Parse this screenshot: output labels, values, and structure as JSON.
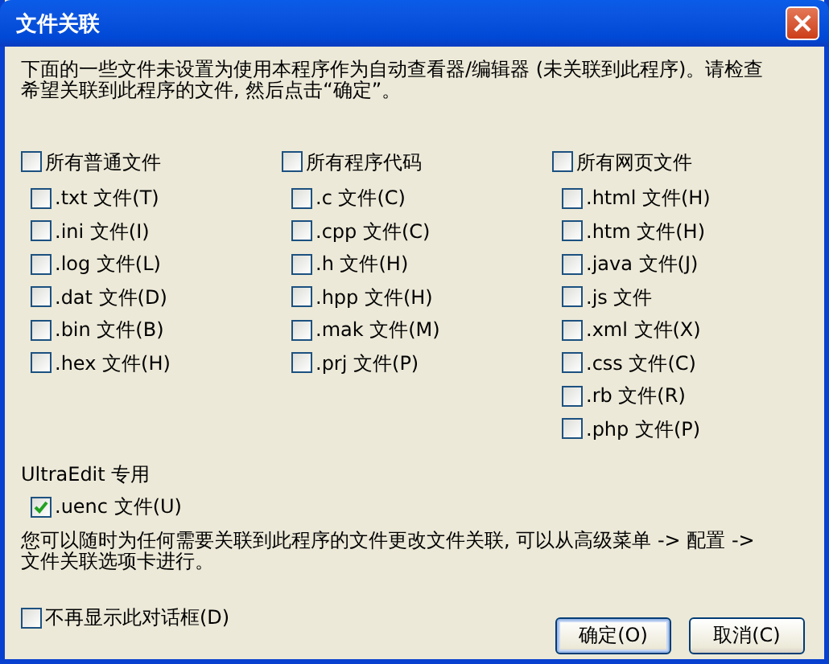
{
  "window": {
    "title": "文件关联"
  },
  "intro": "下面的一些文件未设置为使用本程序作为自动查看器/编辑器 (未关联到此程序)。请检查希望关联到此程序的文件, 然后点击“确定”。",
  "groups": [
    {
      "label": "所有普通文件",
      "checked": false,
      "items": [
        {
          "label": ".txt 文件(T)",
          "checked": false
        },
        {
          "label": ".ini 文件(I)",
          "checked": false
        },
        {
          "label": ".log 文件(L)",
          "checked": false
        },
        {
          "label": ".dat 文件(D)",
          "checked": false
        },
        {
          "label": ".bin 文件(B)",
          "checked": false
        },
        {
          "label": ".hex 文件(H)",
          "checked": false
        }
      ]
    },
    {
      "label": "所有程序代码",
      "checked": false,
      "items": [
        {
          "label": ".c 文件(C)",
          "checked": false
        },
        {
          "label": ".cpp 文件(C)",
          "checked": false
        },
        {
          "label": ".h 文件(H)",
          "checked": false
        },
        {
          "label": ".hpp 文件(H)",
          "checked": false
        },
        {
          "label": ".mak 文件(M)",
          "checked": false
        },
        {
          "label": ".prj 文件(P)",
          "checked": false
        }
      ]
    },
    {
      "label": "所有网页文件",
      "checked": false,
      "items": [
        {
          "label": ".html 文件(H)",
          "checked": false
        },
        {
          "label": ".htm 文件(H)",
          "checked": false
        },
        {
          "label": ".java 文件(J)",
          "checked": false
        },
        {
          "label": ".js 文件",
          "checked": false
        },
        {
          "label": ".xml 文件(X)",
          "checked": false
        },
        {
          "label": ".css 文件(C)",
          "checked": false
        },
        {
          "label": ".rb 文件(R)",
          "checked": false
        },
        {
          "label": ".php 文件(P)",
          "checked": false
        }
      ]
    }
  ],
  "special": {
    "heading": "UltraEdit 专用",
    "items": [
      {
        "label": ".uenc 文件(U)",
        "checked": true
      }
    ]
  },
  "note": "您可以随时为任何需要关联到此程序的文件更改文件关联, 可以从高级菜单 -> 配置 -> 文件关联选项卡进行。",
  "dont_show": {
    "label": "不再显示此对话框(D)",
    "checked": false
  },
  "buttons": [
    {
      "label": "确定(O)",
      "default": true
    },
    {
      "label": "取消(C)",
      "default": false
    }
  ]
}
